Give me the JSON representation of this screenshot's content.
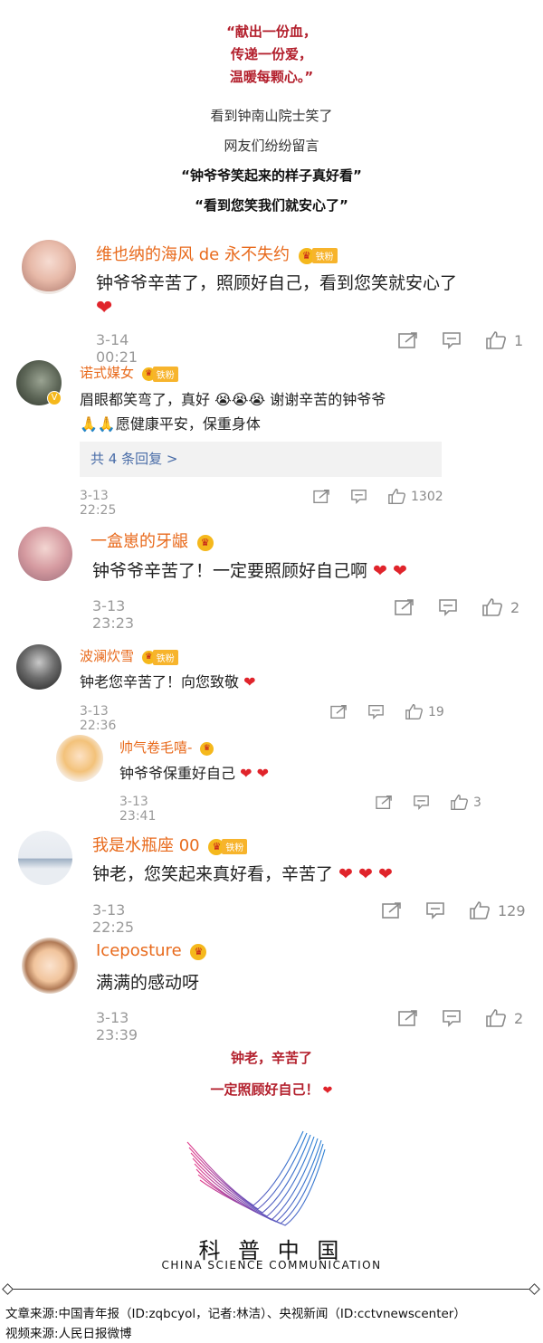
{
  "intro": {
    "red_lines": [
      "“献出一份血，",
      "传递一份爱，",
      "温暖每颗心。”"
    ],
    "line1": "看到钟南山院士笑了",
    "line2": "网友们纷纷留言",
    "quote1": "“钟爷爷笑起来的样子真好看”",
    "quote2": "“看到您笑我们就安心了”"
  },
  "comments": [
    {
      "user": "维也纳的海风 de 永不失约",
      "badge": "铁粉",
      "text": "钟爷爷辛苦了，照顾好自己，看到您笑就安心了",
      "text2": "❤",
      "time": "3-14 00:21",
      "likes": "1"
    },
    {
      "user": "诺式媒女",
      "badge": "铁粉",
      "text": "眉眼都笑弯了，真好 😭😭😭 谢谢辛苦的钟爷爷",
      "text2": "🙏🙏愿健康平安，保重身体",
      "reply": "共 4 条回复 >",
      "time": "3-13 22:25",
      "likes": "1302"
    },
    {
      "user": "一盒崽的牙龈",
      "badge": "",
      "text": "钟爷爷辛苦了！一定要照顾好自己啊 ❤ ❤",
      "time": "3-13 23:23",
      "likes": "2"
    },
    {
      "user": "波澜炊雪",
      "badge": "铁粉",
      "text": "钟老您辛苦了！向您致敬 ❤",
      "time": "3-13 22:36",
      "likes": "19"
    },
    {
      "user": "帅气卷毛嘻-",
      "badge": "",
      "text": "钟爷爷保重好自己 ❤ ❤",
      "time": "3-13 23:41",
      "likes": "3"
    },
    {
      "user": "我是水瓶座 00",
      "badge": "铁粉",
      "text": "钟老，您笑起来真好看，辛苦了 ❤ ❤ ❤",
      "time": "3-13 22:25",
      "likes": "129"
    },
    {
      "user": "Iceposture",
      "badge": "",
      "text": "满满的感动呀",
      "time": "3-13 23:39",
      "likes": "2"
    }
  ],
  "outro": {
    "line1": "钟老，辛苦了",
    "line2": "一定照顾好自己！",
    "heart": "❤"
  },
  "logo": {
    "cn": "科 普 中 国",
    "en": "CHINA SCIENCE COMMUNICATION"
  },
  "footer": {
    "source1": "文章来源:中国青年报（ID:zqbcyol，记者:林洁）、央视新闻（ID:cctvnewscenter）",
    "source2": "视频来源:人民日报微博"
  },
  "colors": {
    "accent_red": "#b3202d",
    "username_orange": "#e86a1c",
    "heart": "#e0242b"
  }
}
